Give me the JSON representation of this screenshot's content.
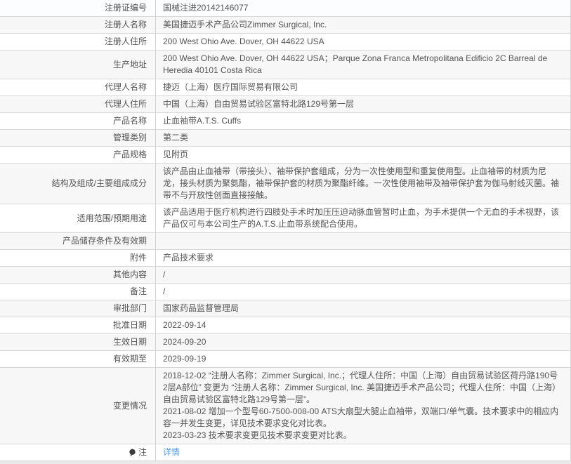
{
  "table": {
    "rows": [
      {
        "label": "注册证编号",
        "value": "国械注进20142146077"
      },
      {
        "label": "注册人名称",
        "value": "美国捷迈手术产品公司Zimmer Surgical, Inc."
      },
      {
        "label": "注册人住所",
        "value": "200 West Ohio Ave. Dover, OH 44622 USA"
      },
      {
        "label": "生产地址",
        "value": "200 West Ohio Ave. Dover, OH 44622 USA；Parque Zona Franca Metropolitana Edificio 2C Barreal de Heredia 40101 Costa Rica"
      },
      {
        "label": "代理人名称",
        "value": "捷迈（上海）医疗国际贸易有限公司"
      },
      {
        "label": "代理人住所",
        "value": "中国（上海）自由贸易试验区富特北路129号第一层"
      },
      {
        "label": "产品名称",
        "value": "止血袖带A.T.S. Cuffs"
      },
      {
        "label": "管理类别",
        "value": "第二类"
      },
      {
        "label": "产品规格",
        "value": "见附页"
      },
      {
        "label": "结构及组成/主要组成成分",
        "value": "该产品由止血袖带（带接头）、袖带保护套组成，分为一次性使用型和重复使用型。止血袖带的材质为尼龙，接头材质为聚氨酯，袖带保护套的材质为聚酯纤维。一次性使用袖带及袖带保护套为伽马射线灭菌。袖带不与开放性创面直接接触。"
      },
      {
        "label": "适用范围/预期用途",
        "value": "该产品适用于医疗机构进行四肢处手术时加压压迫动脉血管暂时止血，为手术提供一个无血的手术视野，该产品仅可与本公司生产的A.T.S.止血带系统配合使用。"
      },
      {
        "label": "产品储存条件及有效期",
        "value": ""
      },
      {
        "label": "附件",
        "value": "产品技术要求"
      },
      {
        "label": "其他内容",
        "value": "/"
      },
      {
        "label": "备注",
        "value": "/"
      },
      {
        "label": "审批部门",
        "value": "国家药品监督管理局"
      },
      {
        "label": "批准日期",
        "value": "2022-09-14"
      },
      {
        "label": "生效日期",
        "value": "2024-09-20"
      },
      {
        "label": "有效期至",
        "value": "2029-09-19"
      },
      {
        "label": "变更情况",
        "value": "2018-12-02 “注册人名称：Zimmer Surgical, Inc.；代理人住所：中国（上海）自由贸易试验区荷丹路190号2层A部位” 变更为 “注册人名称：Zimmer Surgical, Inc. 美国捷迈手术产品公司；代理人住所：中国（上海）自由贸易试验区富特北路129号第一层”。\n2021-08-02 增加一个型号60-7500-008-00 ATS大扇型大腿止血袖带，双端口/单气囊。技术要求中的相应内容一并发生变更，详见技术要求变化对比表。\n2023-03-23 技术要求变更见技术要求变更对比表。"
      }
    ]
  },
  "note_row": {
    "label": "注",
    "link_label": "详情",
    "icon": "note-balloon-icon"
  },
  "colors": {
    "link_blue": "#559be5",
    "row_stripe": "#f7f7f7",
    "row_highlight": "#fbfdff",
    "border": "#d9d9d9",
    "text": "#555555",
    "note_icon": "#3a3a3a",
    "bottom_strip": "#e9e9e9"
  }
}
